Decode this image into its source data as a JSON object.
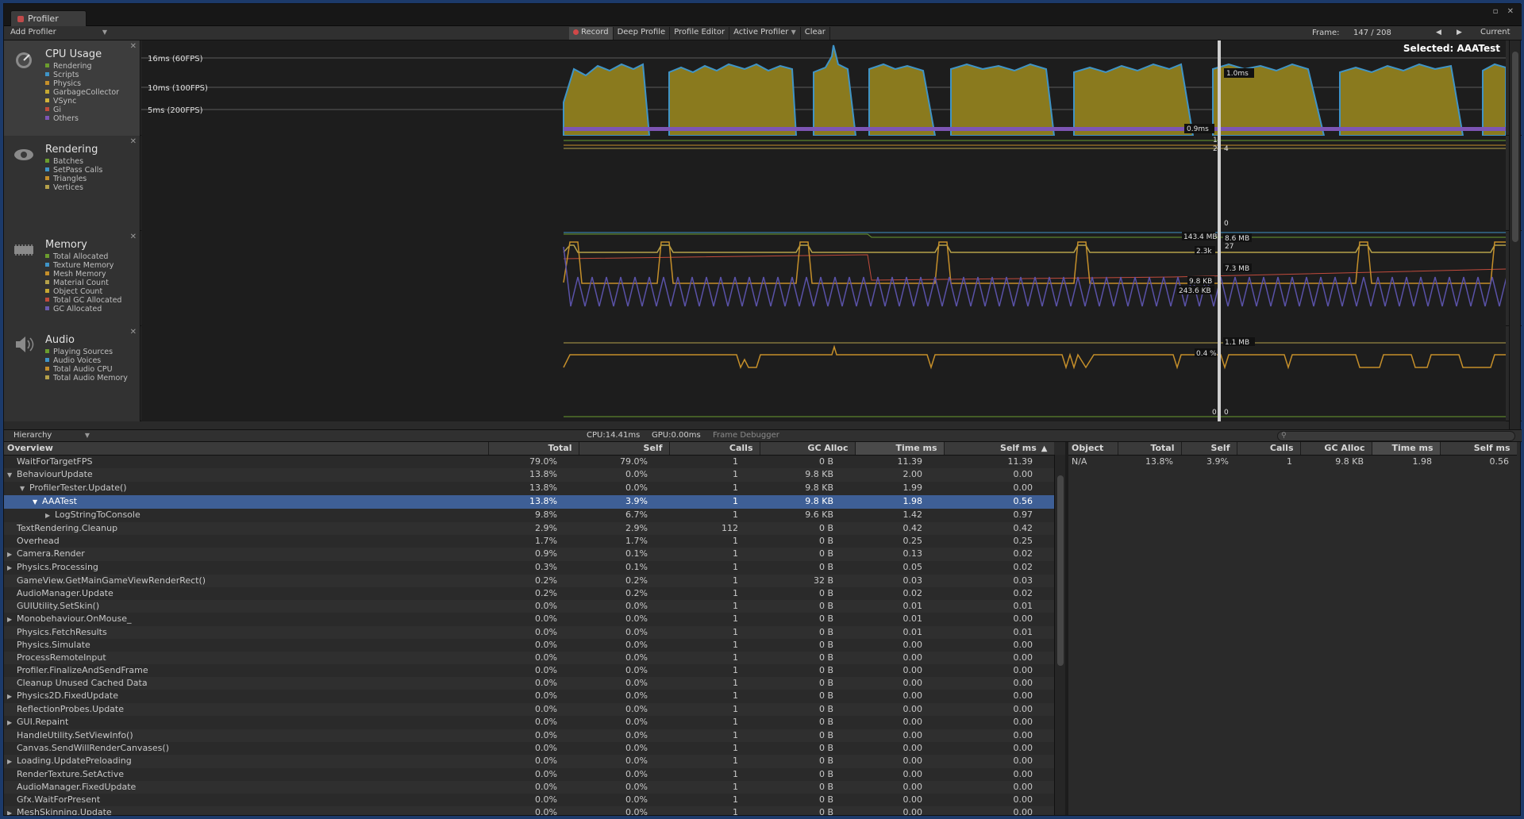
{
  "window": {
    "tab_title": "Profiler"
  },
  "toolbar": {
    "add_profiler": "Add Profiler",
    "record": "Record",
    "deep_profile": "Deep Profile",
    "profile_editor": "Profile Editor",
    "active_profiler": "Active Profiler",
    "clear": "Clear",
    "frame_label": "Frame:",
    "frame_value": "147 / 208",
    "current": "Current"
  },
  "cpu": {
    "title": "CPU Usage",
    "items": [
      "Rendering",
      "Scripts",
      "Physics",
      "GarbageCollector",
      "VSync",
      "Gi",
      "Others"
    ],
    "colors": [
      "#6b9d2e",
      "#3f94c7",
      "#c58f2a",
      "#c6a832",
      "#d1b33a",
      "#c24b3c",
      "#7d55b4"
    ],
    "markers": [
      "16ms (60FPS)",
      "10ms (100FPS)",
      "5ms (200FPS)"
    ],
    "selected": "Selected: AAATest",
    "label_1": "1.0ms",
    "label_2": "0.9ms"
  },
  "rendering": {
    "title": "Rendering",
    "items": [
      "Batches",
      "SetPass Calls",
      "Triangles",
      "Vertices"
    ],
    "colors": [
      "#6b9d2e",
      "#3f94c7",
      "#c58f2a",
      "#b5a14a"
    ],
    "label_1": "1",
    "label_2": "2",
    "label_3": "4",
    "label_4": "0"
  },
  "memory": {
    "title": "Memory",
    "items": [
      "Total Allocated",
      "Texture Memory",
      "Mesh Memory",
      "Material Count",
      "Object Count",
      "Total GC Allocated",
      "GC Allocated"
    ],
    "colors": [
      "#6b9d2e",
      "#3f94c7",
      "#c58f2a",
      "#b5a14a",
      "#c6a832",
      "#c24b3c",
      "#6a5bb0"
    ],
    "label_1": "143.4 MB",
    "label_2": "8.6 MB",
    "label_3": "27",
    "label_4": "2.3k",
    "label_5": "7.3 MB",
    "label_6": "9.8 KB",
    "label_7": "243.6 KB"
  },
  "audio": {
    "title": "Audio",
    "items": [
      "Playing Sources",
      "Audio Voices",
      "Total Audio CPU",
      "Total Audio Memory"
    ],
    "colors": [
      "#6b9d2e",
      "#3f94c7",
      "#c58f2a",
      "#b5a14a"
    ],
    "label_1": "1.1 MB",
    "label_2": "0.4 %",
    "label_3": "0",
    "label_4": "0"
  },
  "hierarchy": {
    "view": "Hierarchy",
    "cpu": "CPU:14.41ms",
    "gpu": "GPU:0.00ms",
    "frame_debugger": "Frame Debugger"
  },
  "table": {
    "columns": [
      "Overview",
      "Total",
      "Self",
      "Calls",
      "GC Alloc",
      "Time ms",
      "Self ms"
    ],
    "rows": [
      {
        "name": "WaitForTargetFPS",
        "indent": 0,
        "toggle": "",
        "total": "79.0%",
        "self": "79.0%",
        "calls": "1",
        "gc": "0 B",
        "time": "11.39",
        "selfms": "11.39"
      },
      {
        "name": "BehaviourUpdate",
        "indent": 0,
        "toggle": "▼",
        "total": "13.8%",
        "self": "0.0%",
        "calls": "1",
        "gc": "9.8 KB",
        "time": "2.00",
        "selfms": "0.00"
      },
      {
        "name": "ProfilerTester.Update()",
        "indent": 1,
        "toggle": "▼",
        "total": "13.8%",
        "self": "0.0%",
        "calls": "1",
        "gc": "9.8 KB",
        "time": "1.99",
        "selfms": "0.00"
      },
      {
        "name": "AAATest",
        "indent": 2,
        "toggle": "▼",
        "total": "13.8%",
        "self": "3.9%",
        "calls": "1",
        "gc": "9.8 KB",
        "time": "1.98",
        "selfms": "0.56"
      },
      {
        "name": "LogStringToConsole",
        "indent": 3,
        "toggle": "▶",
        "total": "9.8%",
        "self": "6.7%",
        "calls": "1",
        "gc": "9.6 KB",
        "time": "1.42",
        "selfms": "0.97"
      },
      {
        "name": "TextRendering.Cleanup",
        "indent": 0,
        "toggle": "",
        "total": "2.9%",
        "self": "2.9%",
        "calls": "112",
        "gc": "0 B",
        "time": "0.42",
        "selfms": "0.42"
      },
      {
        "name": "Overhead",
        "indent": 0,
        "toggle": "",
        "total": "1.7%",
        "self": "1.7%",
        "calls": "1",
        "gc": "0 B",
        "time": "0.25",
        "selfms": "0.25"
      },
      {
        "name": "Camera.Render",
        "indent": 0,
        "toggle": "▶",
        "total": "0.9%",
        "self": "0.1%",
        "calls": "1",
        "gc": "0 B",
        "time": "0.13",
        "selfms": "0.02"
      },
      {
        "name": "Physics.Processing",
        "indent": 0,
        "toggle": "▶",
        "total": "0.3%",
        "self": "0.1%",
        "calls": "1",
        "gc": "0 B",
        "time": "0.05",
        "selfms": "0.02"
      },
      {
        "name": "GameView.GetMainGameViewRenderRect()",
        "indent": 0,
        "toggle": "",
        "total": "0.2%",
        "self": "0.2%",
        "calls": "1",
        "gc": "32 B",
        "time": "0.03",
        "selfms": "0.03"
      },
      {
        "name": "AudioManager.Update",
        "indent": 0,
        "toggle": "",
        "total": "0.2%",
        "self": "0.2%",
        "calls": "1",
        "gc": "0 B",
        "time": "0.02",
        "selfms": "0.02"
      },
      {
        "name": "GUIUtility.SetSkin()",
        "indent": 0,
        "toggle": "",
        "total": "0.0%",
        "self": "0.0%",
        "calls": "1",
        "gc": "0 B",
        "time": "0.01",
        "selfms": "0.01"
      },
      {
        "name": "Monobehaviour.OnMouse_",
        "indent": 0,
        "toggle": "▶",
        "total": "0.0%",
        "self": "0.0%",
        "calls": "1",
        "gc": "0 B",
        "time": "0.01",
        "selfms": "0.00"
      },
      {
        "name": "Physics.FetchResults",
        "indent": 0,
        "toggle": "",
        "total": "0.0%",
        "self": "0.0%",
        "calls": "1",
        "gc": "0 B",
        "time": "0.01",
        "selfms": "0.01"
      },
      {
        "name": "Physics.Simulate",
        "indent": 0,
        "toggle": "",
        "total": "0.0%",
        "self": "0.0%",
        "calls": "1",
        "gc": "0 B",
        "time": "0.00",
        "selfms": "0.00"
      },
      {
        "name": "ProcessRemoteInput",
        "indent": 0,
        "toggle": "",
        "total": "0.0%",
        "self": "0.0%",
        "calls": "1",
        "gc": "0 B",
        "time": "0.00",
        "selfms": "0.00"
      },
      {
        "name": "Profiler.FinalizeAndSendFrame",
        "indent": 0,
        "toggle": "",
        "total": "0.0%",
        "self": "0.0%",
        "calls": "1",
        "gc": "0 B",
        "time": "0.00",
        "selfms": "0.00"
      },
      {
        "name": "Cleanup Unused Cached Data",
        "indent": 0,
        "toggle": "",
        "total": "0.0%",
        "self": "0.0%",
        "calls": "1",
        "gc": "0 B",
        "time": "0.00",
        "selfms": "0.00"
      },
      {
        "name": "Physics2D.FixedUpdate",
        "indent": 0,
        "toggle": "▶",
        "total": "0.0%",
        "self": "0.0%",
        "calls": "1",
        "gc": "0 B",
        "time": "0.00",
        "selfms": "0.00"
      },
      {
        "name": "ReflectionProbes.Update",
        "indent": 0,
        "toggle": "",
        "total": "0.0%",
        "self": "0.0%",
        "calls": "1",
        "gc": "0 B",
        "time": "0.00",
        "selfms": "0.00"
      },
      {
        "name": "GUI.Repaint",
        "indent": 0,
        "toggle": "▶",
        "total": "0.0%",
        "self": "0.0%",
        "calls": "1",
        "gc": "0 B",
        "time": "0.00",
        "selfms": "0.00"
      },
      {
        "name": "HandleUtility.SetViewInfo()",
        "indent": 0,
        "toggle": "",
        "total": "0.0%",
        "self": "0.0%",
        "calls": "1",
        "gc": "0 B",
        "time": "0.00",
        "selfms": "0.00"
      },
      {
        "name": "Canvas.SendWillRenderCanvases()",
        "indent": 0,
        "toggle": "",
        "total": "0.0%",
        "self": "0.0%",
        "calls": "1",
        "gc": "0 B",
        "time": "0.00",
        "selfms": "0.00"
      },
      {
        "name": "Loading.UpdatePreloading",
        "indent": 0,
        "toggle": "▶",
        "total": "0.0%",
        "self": "0.0%",
        "calls": "1",
        "gc": "0 B",
        "time": "0.00",
        "selfms": "0.00"
      },
      {
        "name": "RenderTexture.SetActive",
        "indent": 0,
        "toggle": "",
        "total": "0.0%",
        "self": "0.0%",
        "calls": "1",
        "gc": "0 B",
        "time": "0.00",
        "selfms": "0.00"
      },
      {
        "name": "AudioManager.FixedUpdate",
        "indent": 0,
        "toggle": "",
        "total": "0.0%",
        "self": "0.0%",
        "calls": "1",
        "gc": "0 B",
        "time": "0.00",
        "selfms": "0.00"
      },
      {
        "name": "Gfx.WaitForPresent",
        "indent": 0,
        "toggle": "",
        "total": "0.0%",
        "self": "0.0%",
        "calls": "1",
        "gc": "0 B",
        "time": "0.00",
        "selfms": "0.00"
      },
      {
        "name": "MeshSkinning.Update",
        "indent": 0,
        "toggle": "▶",
        "total": "0.0%",
        "self": "0.0%",
        "calls": "1",
        "gc": "0 B",
        "time": "0.00",
        "selfms": "0.00"
      }
    ],
    "selected_index": 3
  },
  "object_table": {
    "columns": [
      "Object",
      "Total",
      "Self",
      "Calls",
      "GC Alloc",
      "Time ms",
      "Self ms"
    ],
    "rows": [
      {
        "name": "N/A",
        "total": "13.8%",
        "self": "3.9%",
        "calls": "1",
        "gc": "9.8 KB",
        "time": "1.98",
        "selfms": "0.56"
      }
    ]
  }
}
